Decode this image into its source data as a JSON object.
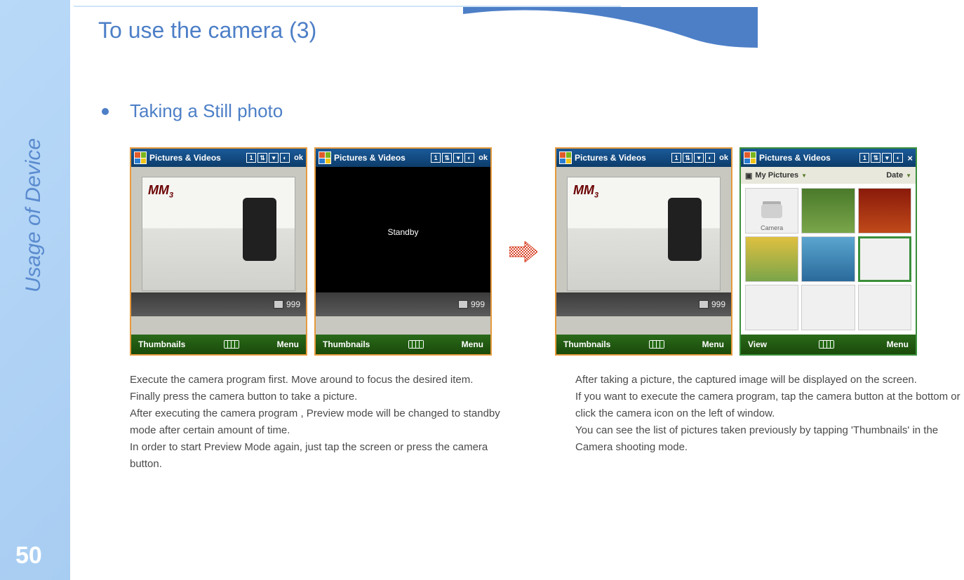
{
  "sidebar": {
    "label": "Usage of Device",
    "page_number": "50"
  },
  "title": "To use the camera (3)",
  "bullet": "Taking a Still photo",
  "mobile": {
    "title": "Pictures & Videos",
    "ok": "ok",
    "counter": "999",
    "menu_left": "Thumbnails",
    "menu_right": "Menu",
    "menu_left_browser": "View",
    "standby": "Standby",
    "mm3": "MM",
    "mm3_sub": "3",
    "browser_folder": "My Pictures",
    "browser_sort": "Date",
    "camera_thumb_label": "Camera"
  },
  "desc_left": [
    "Execute  the camera program first. Move around to focus the desired item.",
    "Finally press the camera button to take a picture.",
    "After executing the camera program , Preview mode will be changed to standby mode after certain amount of time.",
    "In order to start Preview Mode again, just tap the screen or press the camera button."
  ],
  "desc_right": [
    "After taking a picture, the captured image will be displayed on the screen.",
    "If you want to execute the camera program, tap the camera button at the bottom or click the camera icon on the left of window.",
    "You can see the list of pictures taken previously by tapping 'Thumbnails' in the Camera shooting mode."
  ]
}
